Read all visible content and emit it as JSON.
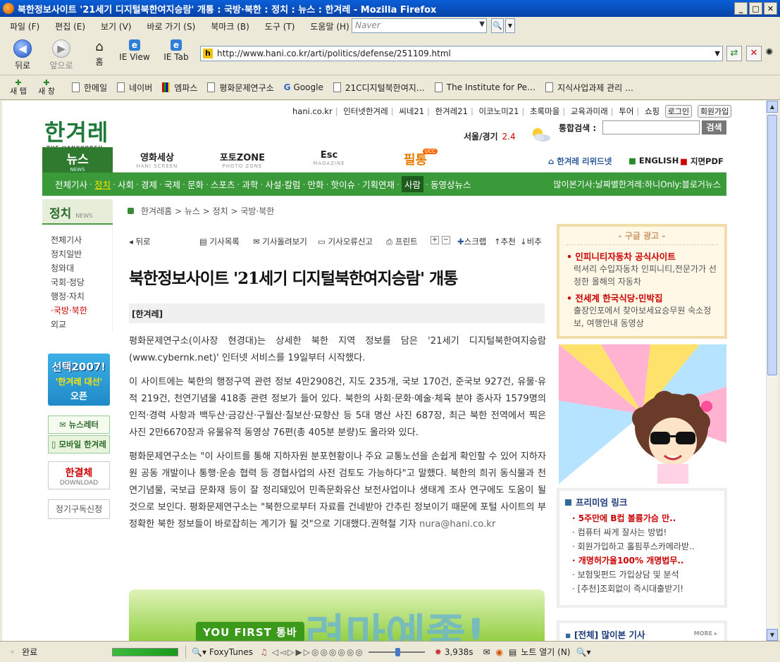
{
  "window": {
    "title": "북한정보사이트 '21세기 디지털북한여지승람' 개통 : 국방·북한 : 정치 : 뉴스 : 한겨레 - Mozilla Firefox"
  },
  "menu": [
    "파일 (F)",
    "편집 (E)",
    "보기 (V)",
    "바로 가기 (S)",
    "북마크 (B)",
    "도구 (T)",
    "도움말 (H)"
  ],
  "search_engine": "Naver",
  "nav": {
    "back": "뒤로",
    "forward": "앞으로",
    "home": "홈",
    "ieview": "IE View",
    "ietab": "IE Tab",
    "url": "http://www.hani.co.kr/arti/politics/defense/251109.html"
  },
  "newtab": "새 탭",
  "newwin": "새 창",
  "bookmarks": [
    "한메일",
    "네이버",
    "엠파스",
    "평화문제연구소",
    "Google",
    "21C디지털북한여지…",
    "The Institute for Pe…",
    "지식사업과제 관리 …"
  ],
  "site": {
    "toplinks": [
      "hani.co.kr",
      "인터넷한겨레",
      "씨네21",
      "한겨레21",
      "이코노미21",
      "초록마을",
      "교육과미래",
      "투어",
      "쇼핑"
    ],
    "login": "로그인",
    "join": "회원가입",
    "logo": "한겨레",
    "logo_sub": "THE HANKYOREH",
    "weather_city": "서울/경기",
    "weather_temp": "2.4",
    "search_label": "통합검색 :",
    "search_btn": "검색",
    "news_tab": "뉴스",
    "news_tab_sub": "NEWS",
    "sections": [
      {
        "t": "영화세상",
        "s": "HANI SCREEN"
      },
      {
        "t": "포토ZONE",
        "s": "PHOTO ZONE"
      },
      {
        "t": "Esc",
        "s": "MAGAZINE"
      }
    ],
    "pildong": "필통",
    "ucc": "UCC",
    "navright": [
      "한겨레 리위드넷",
      "ENGLISH",
      "지면PDF"
    ],
    "greennav": [
      "전체기사",
      "정치",
      "사회",
      "경제",
      "국제",
      "문화",
      "스포츠",
      "과학",
      "사설·칼럼",
      "만화",
      "핫이슈",
      "기획연재",
      "사람",
      "동영상뉴스"
    ],
    "greennav_right": "많이본기사:날짜별한겨레:하니Only:블로거뉴스",
    "left_head": "정치",
    "left_head_sub": "NEWS",
    "left_menu": [
      "전체기사",
      "정치일반",
      "청와대",
      "국회·정당",
      "행정·자치",
      "국방·북한",
      "외교"
    ],
    "banner_2007": "선택2007!",
    "banner_2007_b": "'한겨레 대선'",
    "banner_2007_c": "오픈",
    "newsletter": "뉴스레터",
    "mobile": "모바일 한겨레",
    "font_title": "한결체",
    "font_sub": "DOWNLOAD",
    "subscribe": "정기구독신청",
    "breadcrumb": "한겨레홈 > 뉴스 > 정치 > 국방·북한",
    "tools": [
      "뒤로",
      "기사목록",
      "기사돌려보기",
      "기사오류신고",
      "프린트",
      "스크랩",
      "추천",
      "비추"
    ],
    "headline": "북한정보사이트 '21세기 디지털북한여지승람' 개통",
    "byline": "[한겨레]",
    "paragraphs": [
      "평화문제연구소(이사장 현경대)는 상세한 북한 지역 정보를 담은 '21세기 디지털북한여지승람 (www.cybernk.net)' 인터넷 서비스를 19일부터 시작했다.",
      "이 사이트에는 북한의 행정구역 관련 정보 4만2908건, 지도 235개, 국보 170건, 준국보 927건, 유물·유적 219건, 천연기념물 418종 관련 정보가 들어 있다. 북한의 사회·문화·예술·체육 분야 종사자 1579명의 인적·경력 사항과 백두산·금강산·구월산·칠보산·묘향산 등 5대 명산 사진 687장, 최근 북한 전역에서 찍은 사진 2만6670장과 유물유적 동영상 76편(총 405분 분량)도 올라와 있다.",
      "평화문제연구소는 \"이 사이트를 통해 지하자원 분포현황이나 주요 교통노선을 손쉽게 확인할 수 있어 지하자원 공동 개발이나 통행·운송 협력 등 경협사업의 사전 검토도 가능하다\"고 말했다. 북한의 희귀 동식물과 천연기념물, 국보급 문화재 등이 잘 정리돼있어 민족문화유산 보전사업이나 생태계 조사 연구에도 도움이 될 것으로 보인다. 평화문제연구소는 \"북한으로부터 자료를 건네받아 간추린 정보이기 때문에 포털 사이트의 부정확한 북한 정보들이 바로잡히는 계기가 될 것\"으로 기대했다.권혁철 기자"
    ],
    "email": "nura@hani.co.kr",
    "ad_yourfirst": "YOU FIRST 통바",
    "ad_big": "려마예좋!",
    "google_ad_head": "- 구글 광고 -",
    "google_ads": [
      {
        "t": "인피니티자동차 공식사이트",
        "d": "럭셔리 수입자동차 인피니티,전문가가 선정한 올해의 자동차"
      },
      {
        "t": "전세계 한국식당·민박집",
        "d": "출장인포에서 찾아보세요승무원 숙소정보, 여행안내 동영상"
      }
    ],
    "premium_head": "프리미엄 링크",
    "premium": [
      {
        "t": "5주만에 B컵 볼륨가슴 만..",
        "red": true
      },
      {
        "t": "컴퓨터 싸게 잘사는 방법!",
        "red": false
      },
      {
        "t": "회원가입하고 홀핌푸스카메라받..",
        "red": false
      },
      {
        "t": "개명허가율100% 개명법무..",
        "red": true
      },
      {
        "t": "보험및펀드 가입상담 및 분석",
        "red": false
      },
      {
        "t": "[추천]조회없이 즉시대출받기!",
        "red": false
      }
    ],
    "popular_head": "[전체] 많이본 기사",
    "popular_more": "MORE"
  },
  "status": {
    "text": "완료",
    "foxy": "FoxyTunes",
    "time": "3,938s",
    "notes": "노트 열기 (N)"
  }
}
